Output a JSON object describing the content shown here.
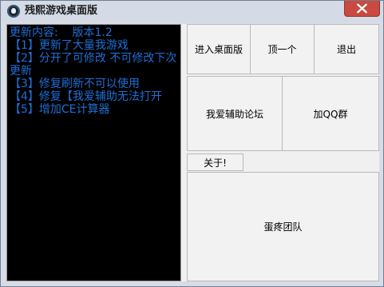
{
  "window": {
    "title": "残熙游戏桌面版",
    "accent": "#c84a40"
  },
  "console": {
    "text": "更新内容:    版本1.2\n【1】更新了大量我游戏\n【2】分开了可修改 不可修改下次更新\n【3】修复刷新不可以使用\n【4】修复【我爱辅助无法打开\n【5】增加CE计算器",
    "color": "#1f6fd6",
    "background": "#000000"
  },
  "buttons": {
    "enter_desktop": "进入桌面版",
    "top_one": "顶一个",
    "exit": "退出",
    "forum": "我爱辅助论坛",
    "join_qq": "加QQ群",
    "about": "关于!",
    "team": "蛋疼团队"
  }
}
